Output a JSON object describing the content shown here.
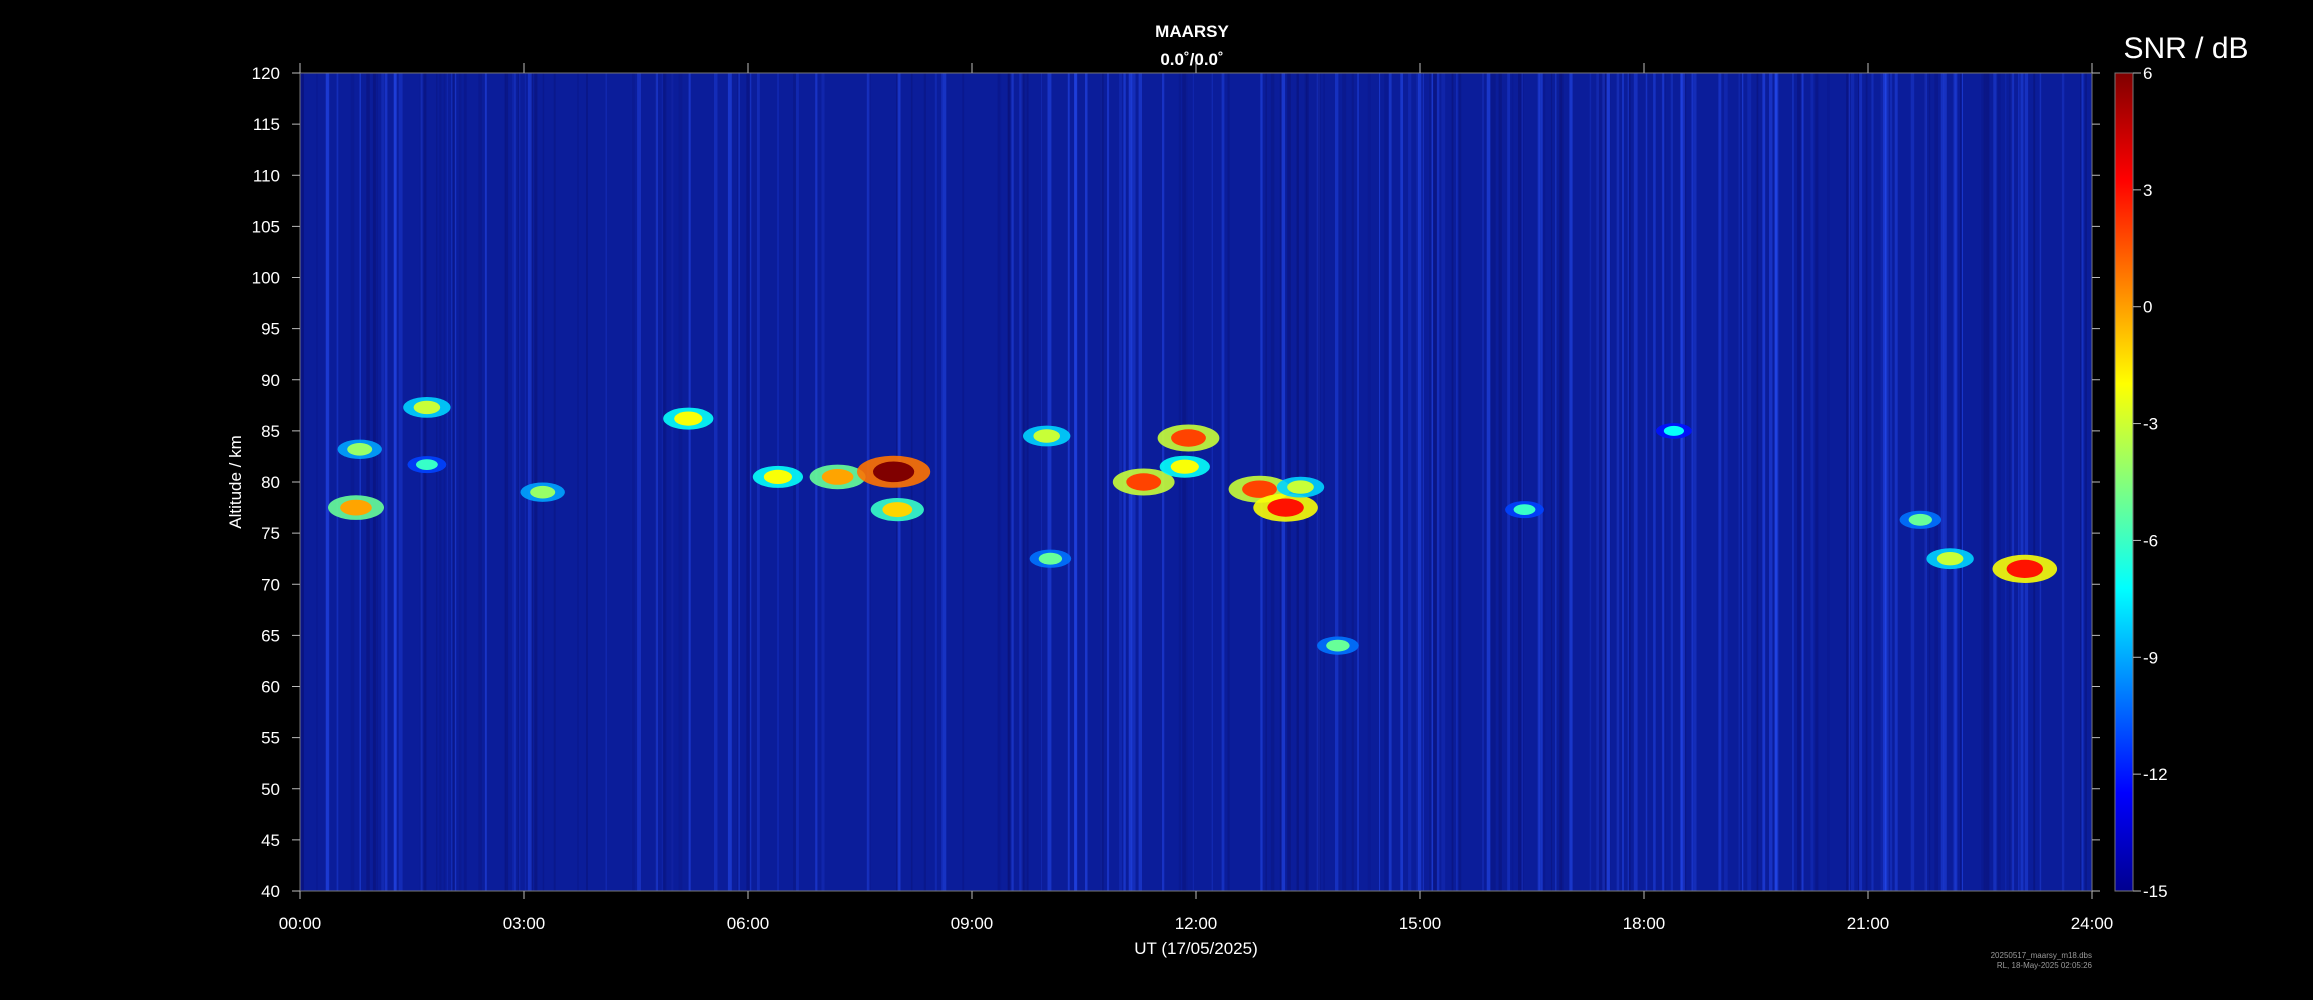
{
  "chart_data": {
    "type": "heatmap",
    "title": "MAARSY",
    "subtitle": "0.0˚/0.0˚",
    "xlabel": "UT (17/05/2025)",
    "ylabel": "Altitude / km",
    "xlim": [
      0,
      24
    ],
    "ylim": [
      40,
      120
    ],
    "x_ticks": [
      "00:00",
      "03:00",
      "06:00",
      "09:00",
      "12:00",
      "15:00",
      "18:00",
      "21:00",
      "24:00"
    ],
    "y_ticks": [
      "40",
      "45",
      "50",
      "55",
      "60",
      "65",
      "70",
      "75",
      "80",
      "85",
      "90",
      "95",
      "100",
      "105",
      "110",
      "115",
      "120"
    ],
    "colorbar": {
      "label": "SNR / dB",
      "range": [
        -15,
        6
      ],
      "ticks": [
        "6",
        "3",
        "0",
        "-3",
        "-6",
        "-9",
        "-12",
        "-15"
      ],
      "colormap": "jet"
    },
    "background_snr_db": -14,
    "echo_features": [
      {
        "time_h": 0.75,
        "alt_km": 77.5,
        "snr_db": 0
      },
      {
        "time_h": 0.8,
        "alt_km": 83.2,
        "snr_db": -4
      },
      {
        "time_h": 1.7,
        "alt_km": 87.3,
        "snr_db": -3
      },
      {
        "time_h": 1.7,
        "alt_km": 81.7,
        "snr_db": -6
      },
      {
        "time_h": 3.25,
        "alt_km": 79.0,
        "snr_db": -4
      },
      {
        "time_h": 5.2,
        "alt_km": 86.2,
        "snr_db": -2
      },
      {
        "time_h": 6.4,
        "alt_km": 80.5,
        "snr_db": -2
      },
      {
        "time_h": 7.2,
        "alt_km": 80.5,
        "snr_db": 0
      },
      {
        "time_h": 7.95,
        "alt_km": 81.0,
        "snr_db": 6
      },
      {
        "time_h": 8.0,
        "alt_km": 77.3,
        "snr_db": -1
      },
      {
        "time_h": 10.05,
        "alt_km": 72.5,
        "snr_db": -5
      },
      {
        "time_h": 10.0,
        "alt_km": 84.5,
        "snr_db": -3
      },
      {
        "time_h": 11.3,
        "alt_km": 80.0,
        "snr_db": 2
      },
      {
        "time_h": 11.9,
        "alt_km": 84.3,
        "snr_db": 2
      },
      {
        "time_h": 11.85,
        "alt_km": 81.5,
        "snr_db": -2
      },
      {
        "time_h": 12.85,
        "alt_km": 79.3,
        "snr_db": 2
      },
      {
        "time_h": 13.2,
        "alt_km": 77.5,
        "snr_db": 3
      },
      {
        "time_h": 13.4,
        "alt_km": 79.5,
        "snr_db": -3
      },
      {
        "time_h": 13.9,
        "alt_km": 64.0,
        "snr_db": -5
      },
      {
        "time_h": 16.4,
        "alt_km": 77.3,
        "snr_db": -6
      },
      {
        "time_h": 18.4,
        "alt_km": 85.0,
        "snr_db": -7
      },
      {
        "time_h": 21.7,
        "alt_km": 76.3,
        "snr_db": -5
      },
      {
        "time_h": 22.1,
        "alt_km": 72.5,
        "snr_db": -3
      },
      {
        "time_h": 23.1,
        "alt_km": 71.5,
        "snr_db": 3
      }
    ],
    "grid": false
  },
  "footer": {
    "file": "20250517_maarsy_m18.dbs",
    "stamp": "RL, 18-May-2025 02:05:26"
  },
  "colors": {
    "background": "#000000",
    "text": "#ffffff"
  }
}
